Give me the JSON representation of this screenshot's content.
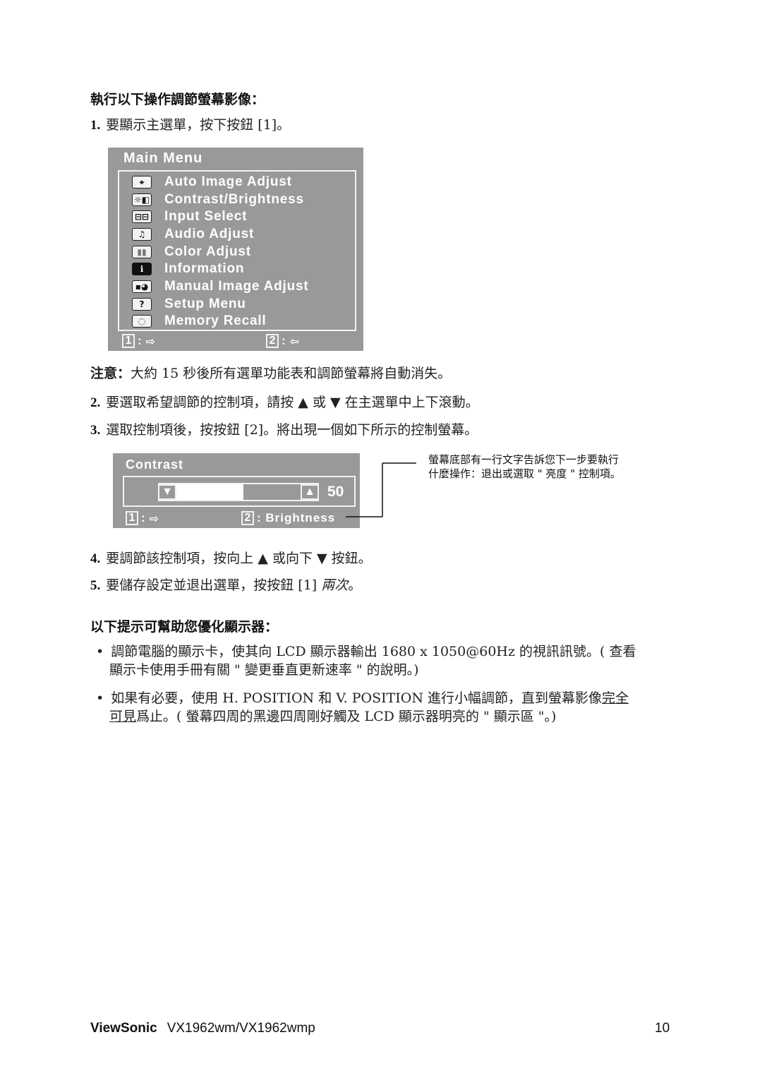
{
  "section1": {
    "heading": "執行以下操作調節螢幕影像：",
    "steps": [
      {
        "num": "1.",
        "text": "要顯示主選單，按下按鈕 [1]。"
      },
      {
        "num": "2.",
        "text": "要選取希望調節的控制項，請按 ▲ 或 ▼ 在主選單中上下滾動。"
      },
      {
        "num": "3.",
        "text": "選取控制項後，按按鈕 [2]。將出現一個如下所示的控制螢幕。"
      },
      {
        "num": "4.",
        "text": "要調節該控制項，按向上 ▲ 或向下 ▼ 按鈕。"
      },
      {
        "num": "5.",
        "text_before": "要儲存設定並退出選單，按按鈕 [1] ",
        "text_italic": "兩次",
        "text_after": "。"
      }
    ],
    "note": {
      "label": "注意：",
      "text": "大約 15 秒後所有選單功能表和調節螢幕將自動消失。"
    }
  },
  "main_menu": {
    "title": "Main Menu",
    "items": [
      {
        "label": "Auto Image Adjust",
        "icon": "crosshair-icon",
        "glyph": "⌖"
      },
      {
        "label": "Contrast/Brightness",
        "icon": "contrast-brightness-icon",
        "glyph": "☼◧"
      },
      {
        "label": "Input Select",
        "icon": "input-select-icon",
        "glyph": "⊟⊟"
      },
      {
        "label": "Audio Adjust",
        "icon": "music-note-icon",
        "glyph": "♫"
      },
      {
        "label": "Color Adjust",
        "icon": "color-bars-icon",
        "glyph": "▮▮"
      },
      {
        "label": "Information",
        "icon": "info-icon",
        "glyph": "ℹ"
      },
      {
        "label": "Manual Image Adjust",
        "icon": "manual-adjust-icon",
        "glyph": "▪◕"
      },
      {
        "label": "Setup Menu",
        "icon": "question-icon",
        "glyph": "?"
      },
      {
        "label": "Memory Recall",
        "icon": "head-profile-icon",
        "glyph": "◌"
      }
    ],
    "footer": [
      {
        "key": "1",
        "icon": "exit-icon",
        "glyph": "⇨"
      },
      {
        "key": "2",
        "icon": "enter-icon",
        "glyph": "⇦"
      }
    ]
  },
  "contrast_panel": {
    "title": "Contrast",
    "value": "50",
    "level_percent": 50,
    "down_glyph": "▼",
    "up_glyph": "▲",
    "footer": [
      {
        "key": "1",
        "icon": "exit-icon",
        "glyph": "⇨",
        "label": ""
      },
      {
        "key": "2",
        "label": ": Brightness"
      }
    ]
  },
  "callout": {
    "line1": "螢幕底部有一行文字告訴您下一步要執行",
    "line2": "什麼操作：退出或選取 \" 亮度 \" 控制項。"
  },
  "section2": {
    "heading": "以下提示可幫助您優化顯示器：",
    "tips": [
      {
        "line1": "調節電腦的顯示卡，使其向 LCD 顯示器輸出 1680 x 1050@60Hz 的視訊訊號。( 查看",
        "line2": "顯示卡使用手冊有關 \" 變更垂直更新速率 \" 的說明。)"
      },
      {
        "line1_before": "如果有必要，使用 H. POSITION 和 V. POSITION 進行小幅調節，直到螢幕影像",
        "line1_underlined": "完全",
        "line2_underlined": "可見",
        "line2_after": "爲止。( 螢幕四周的黑邊四周剛好觸及 LCD 顯示器明亮的 \" 顯示區 \"。)"
      }
    ]
  },
  "footer": {
    "brand": "ViewSonic",
    "model": "VX1962wm/VX1962wmp",
    "page_number": "10"
  }
}
